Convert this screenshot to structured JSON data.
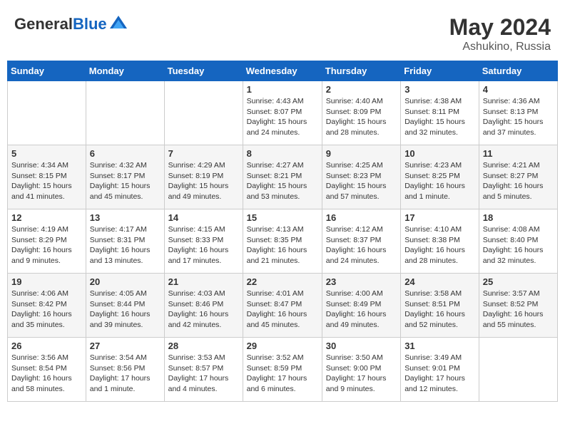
{
  "header": {
    "logo_general": "General",
    "logo_blue": "Blue",
    "month_year": "May 2024",
    "location": "Ashukino, Russia"
  },
  "days_of_week": [
    "Sunday",
    "Monday",
    "Tuesday",
    "Wednesday",
    "Thursday",
    "Friday",
    "Saturday"
  ],
  "weeks": [
    [
      {
        "day": "",
        "sunrise": "",
        "sunset": "",
        "daylight": ""
      },
      {
        "day": "",
        "sunrise": "",
        "sunset": "",
        "daylight": ""
      },
      {
        "day": "",
        "sunrise": "",
        "sunset": "",
        "daylight": ""
      },
      {
        "day": "1",
        "sunrise": "Sunrise: 4:43 AM",
        "sunset": "Sunset: 8:07 PM",
        "daylight": "Daylight: 15 hours and 24 minutes."
      },
      {
        "day": "2",
        "sunrise": "Sunrise: 4:40 AM",
        "sunset": "Sunset: 8:09 PM",
        "daylight": "Daylight: 15 hours and 28 minutes."
      },
      {
        "day": "3",
        "sunrise": "Sunrise: 4:38 AM",
        "sunset": "Sunset: 8:11 PM",
        "daylight": "Daylight: 15 hours and 32 minutes."
      },
      {
        "day": "4",
        "sunrise": "Sunrise: 4:36 AM",
        "sunset": "Sunset: 8:13 PM",
        "daylight": "Daylight: 15 hours and 37 minutes."
      }
    ],
    [
      {
        "day": "5",
        "sunrise": "Sunrise: 4:34 AM",
        "sunset": "Sunset: 8:15 PM",
        "daylight": "Daylight: 15 hours and 41 minutes."
      },
      {
        "day": "6",
        "sunrise": "Sunrise: 4:32 AM",
        "sunset": "Sunset: 8:17 PM",
        "daylight": "Daylight: 15 hours and 45 minutes."
      },
      {
        "day": "7",
        "sunrise": "Sunrise: 4:29 AM",
        "sunset": "Sunset: 8:19 PM",
        "daylight": "Daylight: 15 hours and 49 minutes."
      },
      {
        "day": "8",
        "sunrise": "Sunrise: 4:27 AM",
        "sunset": "Sunset: 8:21 PM",
        "daylight": "Daylight: 15 hours and 53 minutes."
      },
      {
        "day": "9",
        "sunrise": "Sunrise: 4:25 AM",
        "sunset": "Sunset: 8:23 PM",
        "daylight": "Daylight: 15 hours and 57 minutes."
      },
      {
        "day": "10",
        "sunrise": "Sunrise: 4:23 AM",
        "sunset": "Sunset: 8:25 PM",
        "daylight": "Daylight: 16 hours and 1 minute."
      },
      {
        "day": "11",
        "sunrise": "Sunrise: 4:21 AM",
        "sunset": "Sunset: 8:27 PM",
        "daylight": "Daylight: 16 hours and 5 minutes."
      }
    ],
    [
      {
        "day": "12",
        "sunrise": "Sunrise: 4:19 AM",
        "sunset": "Sunset: 8:29 PM",
        "daylight": "Daylight: 16 hours and 9 minutes."
      },
      {
        "day": "13",
        "sunrise": "Sunrise: 4:17 AM",
        "sunset": "Sunset: 8:31 PM",
        "daylight": "Daylight: 16 hours and 13 minutes."
      },
      {
        "day": "14",
        "sunrise": "Sunrise: 4:15 AM",
        "sunset": "Sunset: 8:33 PM",
        "daylight": "Daylight: 16 hours and 17 minutes."
      },
      {
        "day": "15",
        "sunrise": "Sunrise: 4:13 AM",
        "sunset": "Sunset: 8:35 PM",
        "daylight": "Daylight: 16 hours and 21 minutes."
      },
      {
        "day": "16",
        "sunrise": "Sunrise: 4:12 AM",
        "sunset": "Sunset: 8:37 PM",
        "daylight": "Daylight: 16 hours and 24 minutes."
      },
      {
        "day": "17",
        "sunrise": "Sunrise: 4:10 AM",
        "sunset": "Sunset: 8:38 PM",
        "daylight": "Daylight: 16 hours and 28 minutes."
      },
      {
        "day": "18",
        "sunrise": "Sunrise: 4:08 AM",
        "sunset": "Sunset: 8:40 PM",
        "daylight": "Daylight: 16 hours and 32 minutes."
      }
    ],
    [
      {
        "day": "19",
        "sunrise": "Sunrise: 4:06 AM",
        "sunset": "Sunset: 8:42 PM",
        "daylight": "Daylight: 16 hours and 35 minutes."
      },
      {
        "day": "20",
        "sunrise": "Sunrise: 4:05 AM",
        "sunset": "Sunset: 8:44 PM",
        "daylight": "Daylight: 16 hours and 39 minutes."
      },
      {
        "day": "21",
        "sunrise": "Sunrise: 4:03 AM",
        "sunset": "Sunset: 8:46 PM",
        "daylight": "Daylight: 16 hours and 42 minutes."
      },
      {
        "day": "22",
        "sunrise": "Sunrise: 4:01 AM",
        "sunset": "Sunset: 8:47 PM",
        "daylight": "Daylight: 16 hours and 45 minutes."
      },
      {
        "day": "23",
        "sunrise": "Sunrise: 4:00 AM",
        "sunset": "Sunset: 8:49 PM",
        "daylight": "Daylight: 16 hours and 49 minutes."
      },
      {
        "day": "24",
        "sunrise": "Sunrise: 3:58 AM",
        "sunset": "Sunset: 8:51 PM",
        "daylight": "Daylight: 16 hours and 52 minutes."
      },
      {
        "day": "25",
        "sunrise": "Sunrise: 3:57 AM",
        "sunset": "Sunset: 8:52 PM",
        "daylight": "Daylight: 16 hours and 55 minutes."
      }
    ],
    [
      {
        "day": "26",
        "sunrise": "Sunrise: 3:56 AM",
        "sunset": "Sunset: 8:54 PM",
        "daylight": "Daylight: 16 hours and 58 minutes."
      },
      {
        "day": "27",
        "sunrise": "Sunrise: 3:54 AM",
        "sunset": "Sunset: 8:56 PM",
        "daylight": "Daylight: 17 hours and 1 minute."
      },
      {
        "day": "28",
        "sunrise": "Sunrise: 3:53 AM",
        "sunset": "Sunset: 8:57 PM",
        "daylight": "Daylight: 17 hours and 4 minutes."
      },
      {
        "day": "29",
        "sunrise": "Sunrise: 3:52 AM",
        "sunset": "Sunset: 8:59 PM",
        "daylight": "Daylight: 17 hours and 6 minutes."
      },
      {
        "day": "30",
        "sunrise": "Sunrise: 3:50 AM",
        "sunset": "Sunset: 9:00 PM",
        "daylight": "Daylight: 17 hours and 9 minutes."
      },
      {
        "day": "31",
        "sunrise": "Sunrise: 3:49 AM",
        "sunset": "Sunset: 9:01 PM",
        "daylight": "Daylight: 17 hours and 12 minutes."
      },
      {
        "day": "",
        "sunrise": "",
        "sunset": "",
        "daylight": ""
      }
    ]
  ]
}
